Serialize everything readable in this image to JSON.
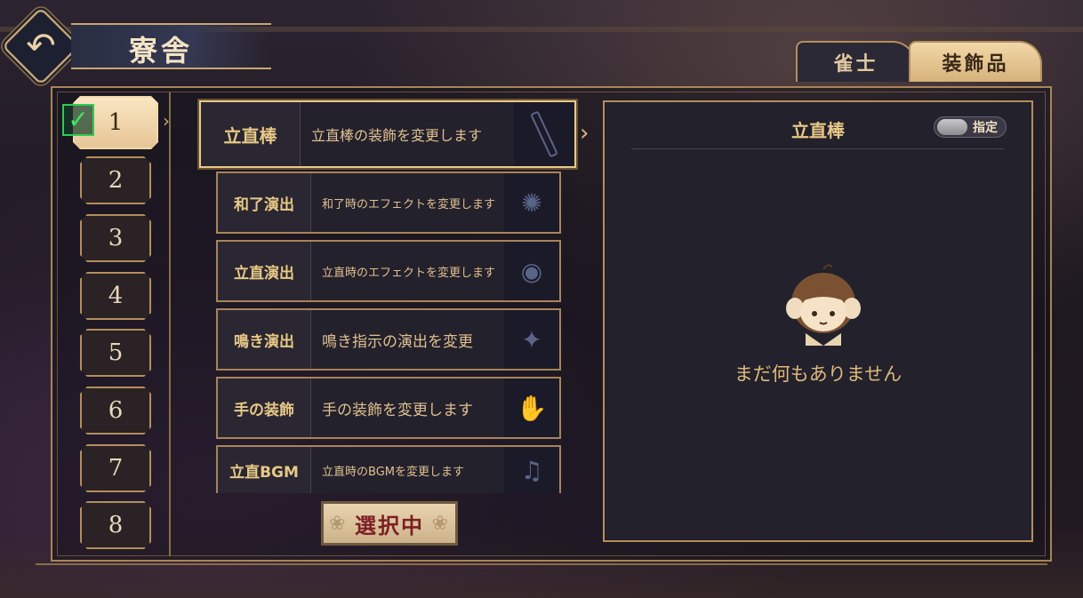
{
  "header": {
    "title": "寮舎"
  },
  "tabs": [
    {
      "label": "雀士",
      "active": false
    },
    {
      "label": "装飾品",
      "active": true
    }
  ],
  "slots": [
    "1",
    "2",
    "3",
    "4",
    "5",
    "6",
    "7",
    "8"
  ],
  "active_slot": "1",
  "items": [
    {
      "name": "立直棒",
      "desc": "立直棒の装飾を変更します"
    },
    {
      "name": "和了演出",
      "desc": "和了時のエフェクトを変更します"
    },
    {
      "name": "立直演出",
      "desc": "立直時のエフェクトを変更します"
    },
    {
      "name": "鳴き演出",
      "desc": "鳴き指示の演出を変更"
    },
    {
      "name": "手の装飾",
      "desc": "手の装飾を変更します"
    },
    {
      "name": "立直BGM",
      "desc": "立直時のBGMを変更します"
    }
  ],
  "select_button": "選択中",
  "detail": {
    "title": "立直棒",
    "toggle_label": "指定",
    "empty_text": "まだ何もありません"
  },
  "colors": {
    "accent": "#e0b978",
    "frame": "#b48e5c",
    "panel": "#22212c",
    "check": "#2ecc55"
  }
}
